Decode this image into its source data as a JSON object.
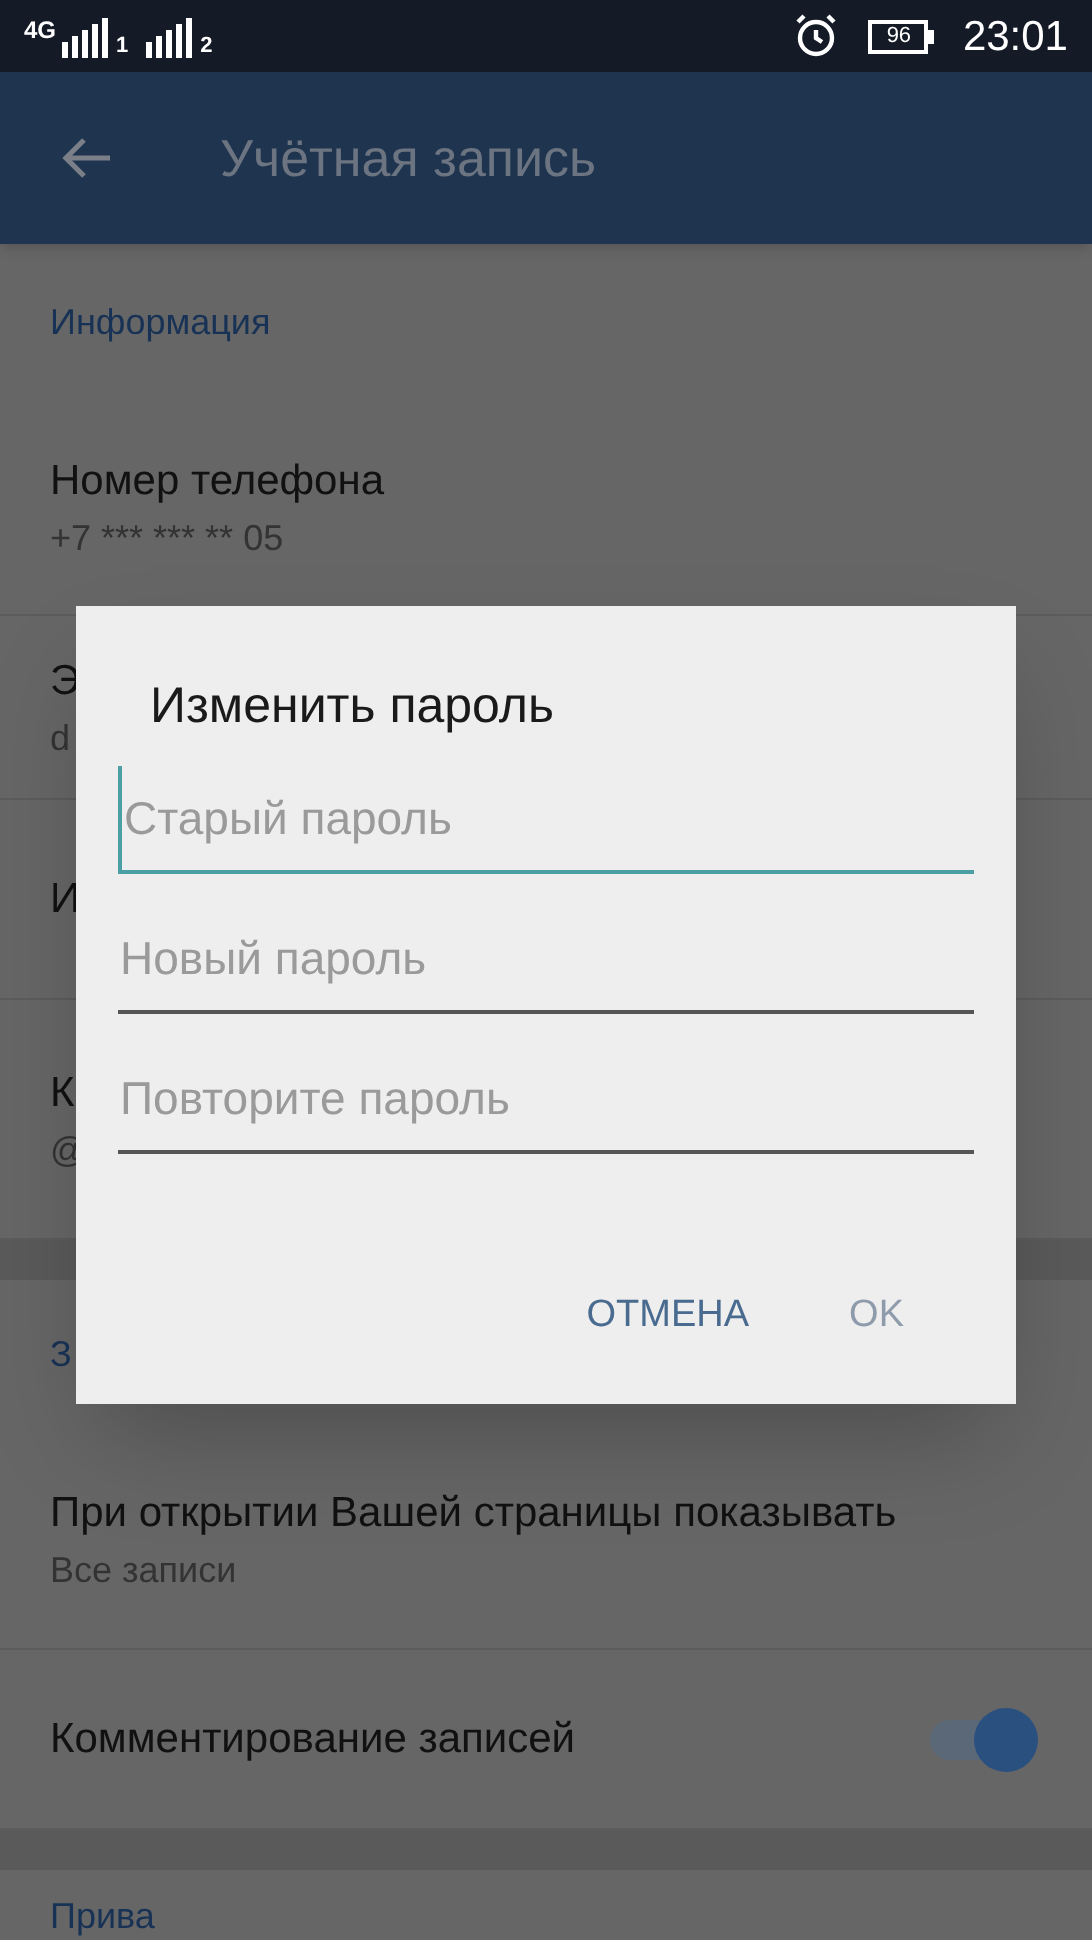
{
  "status_bar": {
    "network": "4G",
    "sim_labels": [
      "1",
      "2"
    ],
    "battery": "96",
    "time": "23:01"
  },
  "app_bar": {
    "title": "Учётная запись"
  },
  "sections": [
    {
      "header": "Информация",
      "items": [
        {
          "kind": "text",
          "title": "Номер телефона",
          "subtitle": "+7 *** *** ** 05"
        },
        {
          "kind": "text",
          "title": "Э",
          "subtitle": "d"
        },
        {
          "kind": "text",
          "title": "И"
        },
        {
          "kind": "text",
          "title": "К",
          "subtitle": "@"
        }
      ]
    },
    {
      "header": "З",
      "items": [
        {
          "kind": "text",
          "title": "При открытии Вашей страницы показывать",
          "subtitle": "Все записи"
        },
        {
          "kind": "switch",
          "title": "Комментирование записей",
          "on": true
        }
      ]
    },
    {
      "header": "Прива"
    }
  ],
  "dialog": {
    "title": "Изменить пароль",
    "fields": [
      {
        "placeholder": "Старый пароль",
        "focused": true
      },
      {
        "placeholder": "Новый пароль",
        "focused": false
      },
      {
        "placeholder": "Повторите пароль",
        "focused": false
      }
    ],
    "buttons": [
      {
        "label": "ОТМЕНА",
        "disabled": false
      },
      {
        "label": "OK",
        "disabled": true
      }
    ]
  }
}
